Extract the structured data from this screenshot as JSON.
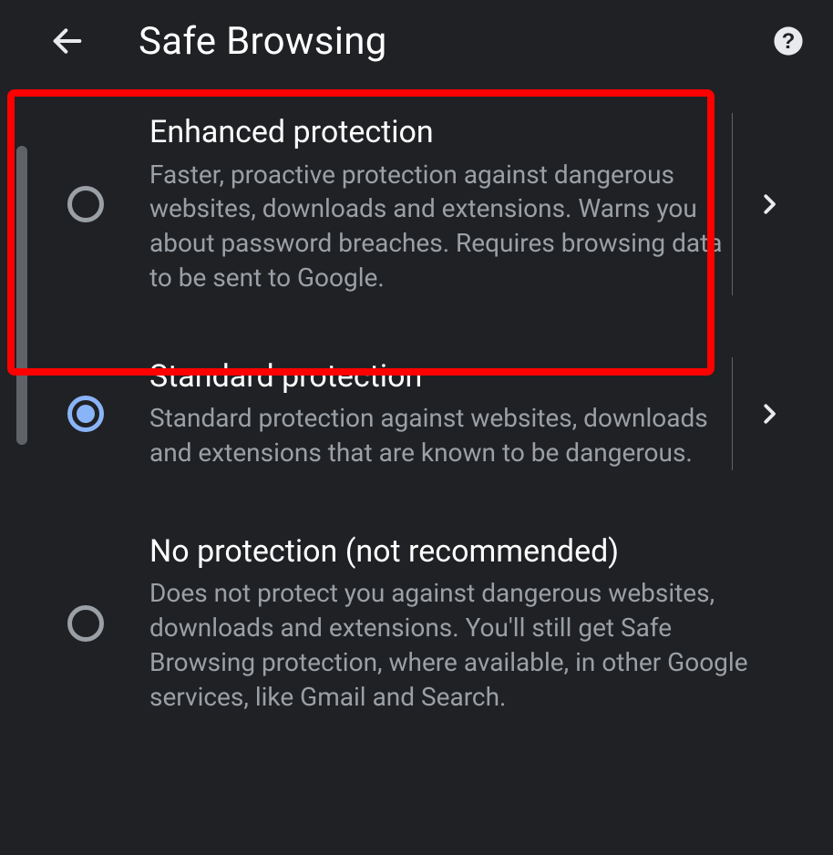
{
  "header": {
    "title": "Safe Browsing"
  },
  "options": [
    {
      "id": "enhanced",
      "title": "Enhanced protection",
      "description": "Faster, proactive protection against dangerous websites, downloads and extensions. Warns you about password breaches. Requires browsing data to be sent to Google.",
      "selected": false,
      "has_details": true,
      "highlighted": true
    },
    {
      "id": "standard",
      "title": "Standard protection",
      "description": "Standard protection against websites, downloads and extensions that are known to be dangerous.",
      "selected": true,
      "has_details": true,
      "highlighted": false
    },
    {
      "id": "none",
      "title": "No protection (not recommended)",
      "description": "Does not protect you against dangerous websites, downloads and extensions. You'll still get Safe Browsing protection, where available, in other Google services, like Gmail and Search.",
      "selected": false,
      "has_details": false,
      "highlighted": false
    }
  ]
}
